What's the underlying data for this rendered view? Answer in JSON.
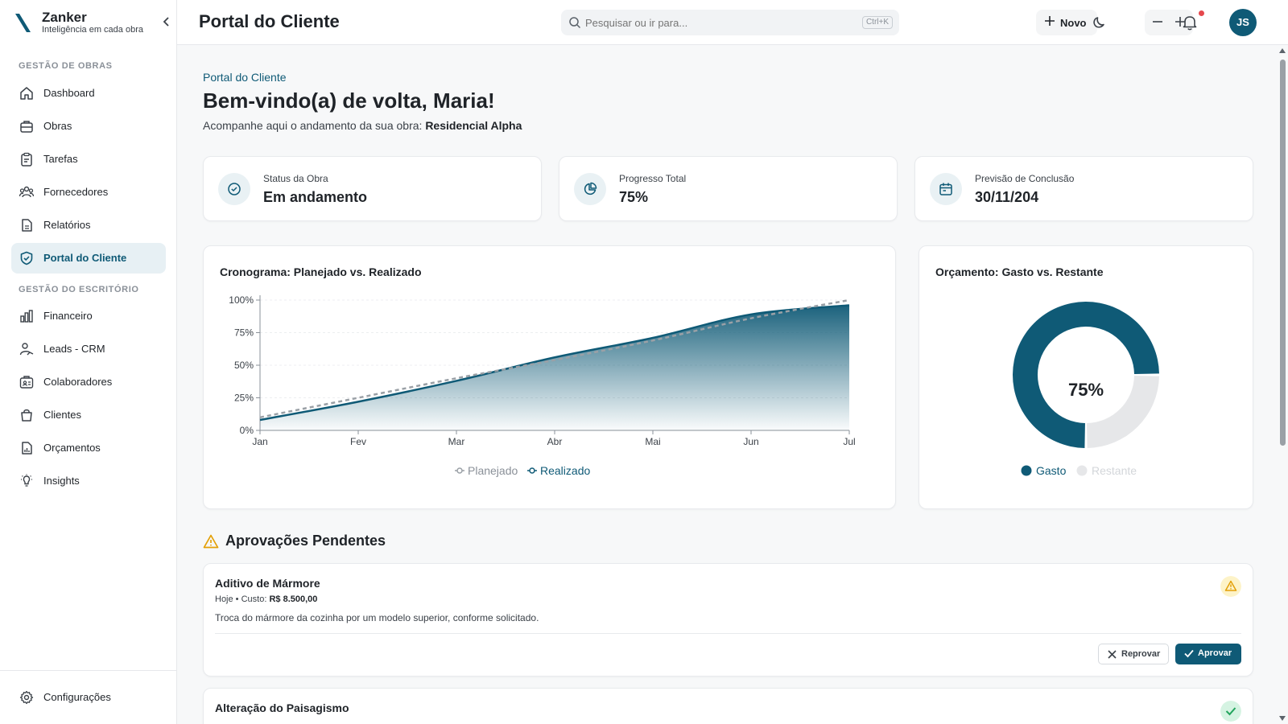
{
  "app": {
    "brand_name": "Zanker",
    "brand_tagline": "Inteligência em cada obra"
  },
  "sidebar": {
    "section_obras": "GESTÃO DE OBRAS",
    "section_escritorio": "GESTÃO DO ESCRITÓRIO",
    "items": [
      {
        "label": "Dashboard",
        "icon": "home-icon"
      },
      {
        "label": "Obras",
        "icon": "briefcase-icon"
      },
      {
        "label": "Tarefas",
        "icon": "clipboard-icon"
      },
      {
        "label": "Fornecedores",
        "icon": "users-icon"
      },
      {
        "label": "Relatórios",
        "icon": "file-icon"
      },
      {
        "label": "Portal do Cliente",
        "icon": "shield-check-icon",
        "active": true
      },
      {
        "label": "Financeiro",
        "icon": "bar-chart-icon"
      },
      {
        "label": "Leads - CRM",
        "icon": "user-handshake-icon"
      },
      {
        "label": "Colaboradores",
        "icon": "id-card-icon"
      },
      {
        "label": "Clientes",
        "icon": "shopping-bag-icon"
      },
      {
        "label": "Orçamentos",
        "icon": "file-chart-icon"
      },
      {
        "label": "Insights",
        "icon": "lightbulb-icon"
      }
    ],
    "settings_label": "Configurações"
  },
  "topbar": {
    "title": "Portal do Cliente",
    "search_placeholder": "Pesquisar ou ir para...",
    "search_shortcut": "Ctrl+K",
    "new_label": "Novo",
    "avatar_initials": "JS"
  },
  "main": {
    "breadcrumb": "Portal do Cliente",
    "welcome": "Bem-vindo(a) de volta, Maria!",
    "subtitle_prefix": "Acompanhe aqui o andamento da sua obra:",
    "project_name": "Residencial Alpha",
    "stats": [
      {
        "label": "Status da Obra",
        "value": "Em andamento",
        "icon": "check-circle-icon"
      },
      {
        "label": "Progresso Total",
        "value": "75%",
        "icon": "pie-chart-icon"
      },
      {
        "label": "Previsão de Conclusão",
        "value": "30/11/204",
        "icon": "calendar-icon"
      }
    ],
    "approvals_title": "Aprovações Pendentes",
    "approvals": [
      {
        "title": "Aditivo de Mármore",
        "when": "Hoje",
        "cost_label": "Custo:",
        "cost": "R$ 8.500,00",
        "description": "Troca do mármore da cozinha por um modelo superior, conforme solicitado.",
        "reject_label": "Reprovar",
        "approve_label": "Aprovar",
        "status": "warning"
      },
      {
        "title": "Alteração do Paisagismo",
        "status": "approved"
      }
    ]
  },
  "colors": {
    "primary": "#0f5a76",
    "planned": "#9aa0a6",
    "remaining": "#e6e7e9",
    "warning": "#e3a008",
    "success": "#22a45d"
  },
  "chart_data": [
    {
      "type": "area",
      "title": "Cronograma: Planejado vs. Realizado",
      "categories": [
        "Jan",
        "Fev",
        "Mar",
        "Abr",
        "Mai",
        "Jun",
        "Jul"
      ],
      "y_ticks": [
        "0%",
        "25%",
        "50%",
        "75%",
        "100%"
      ],
      "ylim": [
        0,
        100
      ],
      "series": [
        {
          "name": "Planejado",
          "values": [
            10,
            25,
            40,
            54,
            69,
            86,
            100
          ]
        },
        {
          "name": "Realizado",
          "values": [
            8,
            22,
            38,
            56,
            71,
            89,
            96
          ]
        }
      ],
      "legend": "bottom-center",
      "grid": true
    },
    {
      "type": "pie",
      "title": "Orçamento: Gasto vs. Restante",
      "center_label": "75%",
      "slices": [
        {
          "name": "Gasto",
          "value": 75
        },
        {
          "name": "Restante",
          "value": 25
        }
      ],
      "legend": "bottom-center"
    }
  ]
}
